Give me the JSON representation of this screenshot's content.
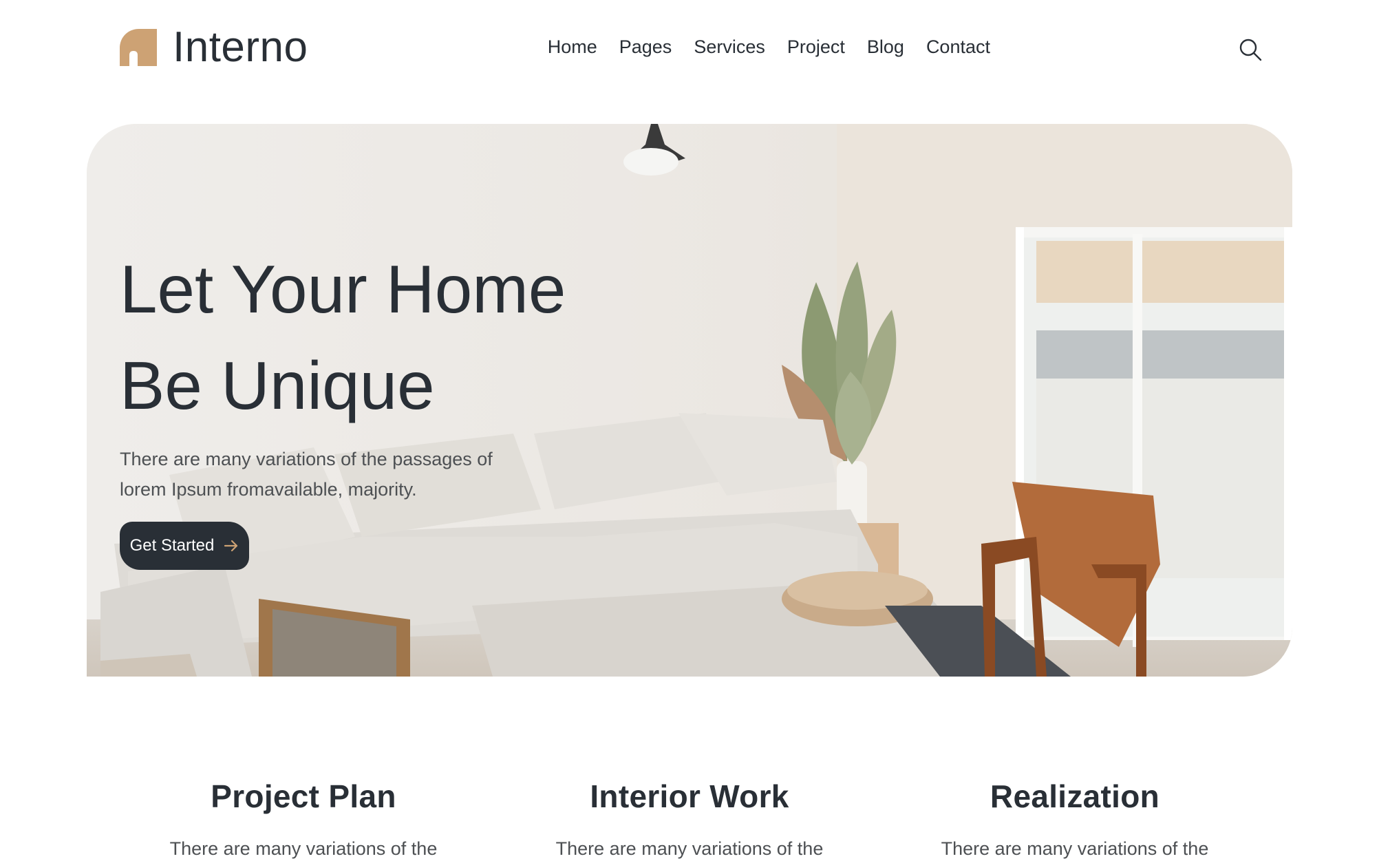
{
  "brand": {
    "name": "Interno",
    "accent": "#CDA274",
    "dark": "#292F36"
  },
  "nav": {
    "items": [
      {
        "label": "Home"
      },
      {
        "label": "Pages"
      },
      {
        "label": "Services"
      },
      {
        "label": "Project"
      },
      {
        "label": "Blog"
      },
      {
        "label": "Contact"
      }
    ],
    "search_icon": "search-icon"
  },
  "hero": {
    "title_line1": "Let Your Home",
    "title_line2": "Be Unique",
    "subtitle": "There are many variations of the passages of lorem Ipsum fromavailable, majority.",
    "cta_label": "Get Started",
    "cta_icon": "arrow-right-icon"
  },
  "features": [
    {
      "title": "Project Plan",
      "text": "There are many variations of the"
    },
    {
      "title": "Interior Work",
      "text": "There are many variations of the"
    },
    {
      "title": "Realization",
      "text": "There are many variations of the"
    }
  ]
}
